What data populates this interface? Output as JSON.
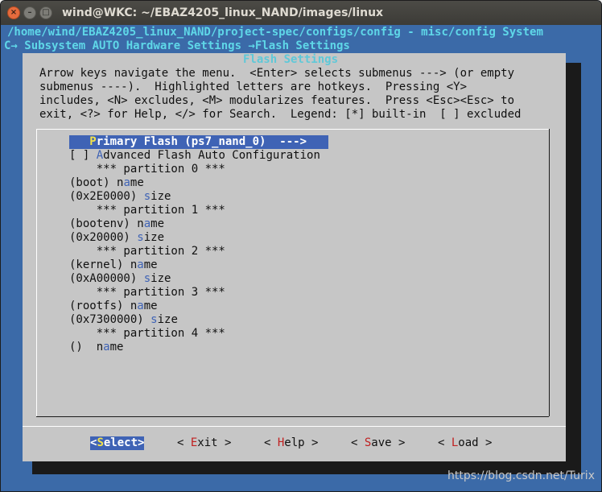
{
  "window": {
    "title": "wind@WKC: ~/EBAZ4205_linux_NAND/images/linux",
    "close_glyph": "×",
    "minimize_glyph": "–",
    "maximize_glyph": "□"
  },
  "header": {
    "path": "/home/wind/EBAZ4205_linux_NAND/project-spec/configs/config - misc/config System",
    "breadcrumb": "C→ Subsystem AUTO Hardware Settings →Flash Settings"
  },
  "dialog": {
    "title": "Flash Settings",
    "description": [
      "Arrow keys navigate the menu.  <Enter> selects submenus ---> (or empty",
      "submenus ----).  Highlighted letters are hotkeys.  Pressing <Y>",
      "includes, <N> excludes, <M> modularizes features.  Press <Esc><Esc> to",
      "exit, <?> for Help, </> for Search.  Legend: [*] built-in  [ ] excluded"
    ]
  },
  "menu": {
    "selected": {
      "pre": "   ",
      "hotkey": "P",
      "rest": "rimary Flash (ps7_nand_0)  --->"
    },
    "advanced": {
      "pre": "[ ] ",
      "hotkey": "A",
      "rest": "dvanced Flash Auto Configuration"
    },
    "partition_0": "    *** partition 0 ***",
    "p0_name": {
      "pre": "(boot) ",
      "before": "n",
      "hotkey": "a",
      "after": "me"
    },
    "p0_size": {
      "pre": "(0x2E0000) ",
      "hotkey": "s",
      "after": "ize"
    },
    "partition_1": "    *** partition 1 ***",
    "p1_name": {
      "pre": "(bootenv) ",
      "before": "n",
      "hotkey": "a",
      "after": "me"
    },
    "p1_size": {
      "pre": "(0x20000) ",
      "hotkey": "s",
      "after": "ize"
    },
    "partition_2": "    *** partition 2 ***",
    "p2_name": {
      "pre": "(kernel) ",
      "before": "n",
      "hotkey": "a",
      "after": "me"
    },
    "p2_size": {
      "pre": "(0xA00000) ",
      "hotkey": "s",
      "after": "ize"
    },
    "partition_3": "    *** partition 3 ***",
    "p3_name": {
      "pre": "(rootfs) ",
      "before": "n",
      "hotkey": "a",
      "after": "me"
    },
    "p3_size": {
      "pre": "(0x7300000) ",
      "hotkey": "s",
      "after": "ize"
    },
    "partition_4": "    *** partition 4 ***",
    "p4_name": {
      "pre": "()  ",
      "before": "n",
      "hotkey": "a",
      "after": "me"
    }
  },
  "buttons": {
    "select": {
      "pre": "<",
      "hotkey": "S",
      "post": "elect>"
    },
    "exit": {
      "pre": "< ",
      "hotkey": "E",
      "post": "xit >"
    },
    "help": {
      "pre": "< ",
      "hotkey": "H",
      "post": "elp >"
    },
    "save": {
      "pre": "< ",
      "hotkey": "S",
      "post": "ave >"
    },
    "load": {
      "pre": "< ",
      "hotkey": "L",
      "post": "oad >"
    }
  },
  "watermark": "https://blog.csdn.net/Turix",
  "colors": {
    "terminal_bg": "#3b6aa8",
    "dialog_bg": "#c6c6c6",
    "selection_bg": "#3f63b5",
    "hotkey": "#3f63b5",
    "selected_hotkey": "#f2e24a",
    "button_hotkey": "#c02020",
    "header_text": "#5fd7e8"
  }
}
